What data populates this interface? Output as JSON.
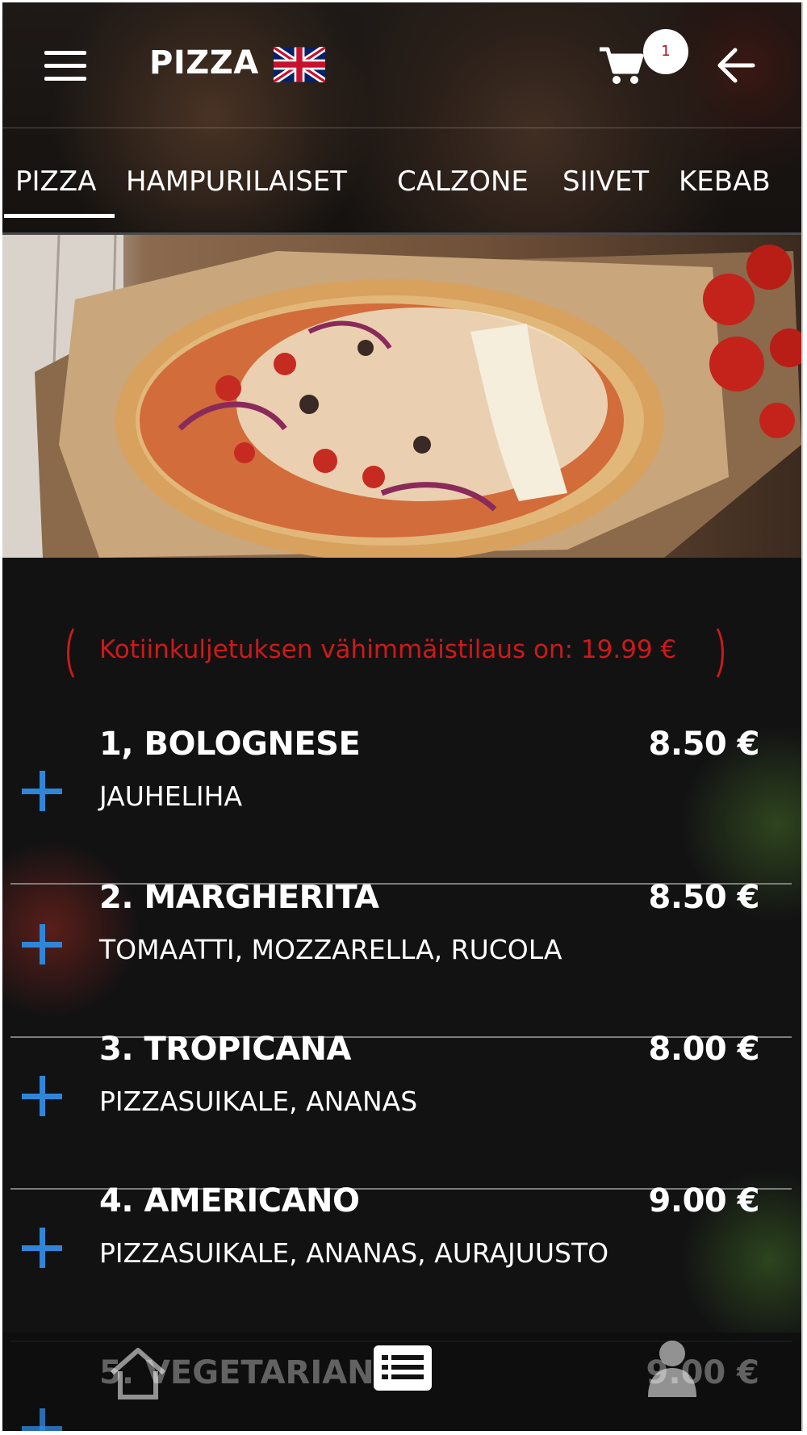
{
  "header": {
    "title": "PIZZA",
    "language_icon": "uk-flag-icon",
    "cart_count": "1",
    "back_icon": "arrow-left-icon",
    "menu_icon": "hamburger-icon"
  },
  "tabs": [
    {
      "label": "PIZZA",
      "active": true
    },
    {
      "label": "HAMPURILAISET",
      "active": false
    },
    {
      "label": "CALZONE",
      "active": false
    },
    {
      "label": "SIIVET",
      "active": false
    },
    {
      "label": "KEBAB",
      "active": false
    }
  ],
  "notice": "Kotiinkuljetuksen vähimmäistilaus on: 19.99 €",
  "menu": {
    "items": [
      {
        "name": "1, BOLOGNESE",
        "price": "8.50 €",
        "desc": "JAUHELIHA"
      },
      {
        "name": "2. MARGHERITA",
        "price": "8.50 €",
        "desc": "TOMAATTI, MOZZARELLA, RUCOLA"
      },
      {
        "name": "3. TROPICANA",
        "price": "8.00 €",
        "desc": "PIZZASUIKALE, ANANAS"
      },
      {
        "name": "4. AMERICANO",
        "price": "9.00 €",
        "desc": "PIZZASUIKALE, ANANAS, AURAJUUSTO"
      },
      {
        "name": "5. VEGETARIANA",
        "price": "9.00 €",
        "desc": ""
      }
    ]
  },
  "bottom_nav": {
    "home_icon": "home-icon",
    "menu_icon": "menu-list-icon",
    "user_icon": "user-icon"
  },
  "colors": {
    "accent_blue": "#2f86d8",
    "notice_red": "#cc1a1a",
    "badge_text": "#b1121a",
    "background": "#121213"
  }
}
